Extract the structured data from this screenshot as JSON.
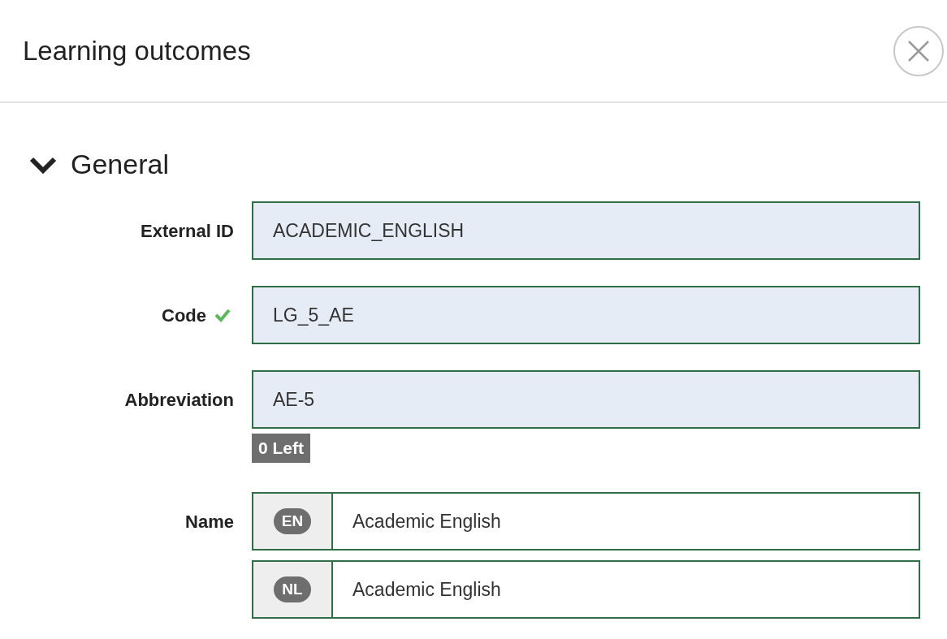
{
  "title": "Learning outcomes",
  "section": {
    "title": "General",
    "expanded": true
  },
  "fields": [
    {
      "label": "External ID",
      "value": "ACADEMIC_ENGLISH",
      "valid": false
    },
    {
      "label": "Code",
      "value": "LG_5_AE",
      "valid": true
    },
    {
      "label": "Abbreviation",
      "value": "AE-5",
      "valid": false,
      "counter": "0 Left"
    }
  ],
  "name": {
    "label": "Name",
    "translations": [
      {
        "lang": "EN",
        "value": "Academic English"
      },
      {
        "lang": "NL",
        "value": "Academic English"
      }
    ]
  }
}
